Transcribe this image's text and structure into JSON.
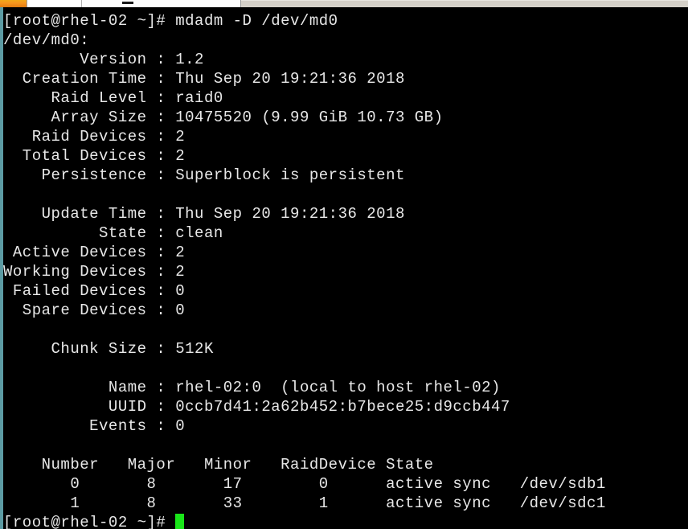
{
  "window": {
    "app_icon": "terminal-app-icon",
    "minimize_glyph": "minimize-icon",
    "title": ""
  },
  "terminal": {
    "colors": {
      "background": "#000000",
      "foreground": "#e8e8e8",
      "cursor": "#19e619",
      "border_left": "#5c9ba3",
      "chrome": "#d4d0c8",
      "icon_orange": "#f7941e"
    },
    "prompt": "[root@rhel-02 ~]#",
    "command": "mdadm -D /dev/md0",
    "lines": [
      "[root@rhel-02 ~]# mdadm -D /dev/md0",
      "/dev/md0:",
      "        Version : 1.2",
      "  Creation Time : Thu Sep 20 19:21:36 2018",
      "     Raid Level : raid0",
      "     Array Size : 10475520 (9.99 GiB 10.73 GB)",
      "   Raid Devices : 2",
      "  Total Devices : 2",
      "    Persistence : Superblock is persistent",
      "",
      "    Update Time : Thu Sep 20 19:21:36 2018",
      "          State : clean",
      " Active Devices : 2",
      "Working Devices : 2",
      " Failed Devices : 0",
      "  Spare Devices : 0",
      "",
      "     Chunk Size : 512K",
      "",
      "           Name : rhel-02:0  (local to host rhel-02)",
      "           UUID : 0ccb7d41:2a62b452:b7bece25:d9ccb447",
      "         Events : 0",
      "",
      "    Number   Major   Minor   RaidDevice State",
      "       0       8       17        0      active sync   /dev/sdb1",
      "       1       8       33        1      active sync   /dev/sdc1"
    ],
    "final_prompt": "[root@rhel-02 ~]# ",
    "cursor": "block-cursor"
  },
  "mdadm_detail": {
    "device": "/dev/md0",
    "fields": {
      "Version": "1.2",
      "Creation Time": "Thu Sep 20 19:21:36 2018",
      "Raid Level": "raid0",
      "Array Size": "10475520 (9.99 GiB 10.73 GB)",
      "Raid Devices": "2",
      "Total Devices": "2",
      "Persistence": "Superblock is persistent",
      "Update Time": "Thu Sep 20 19:21:36 2018",
      "State": "clean",
      "Active Devices": "2",
      "Working Devices": "2",
      "Failed Devices": "0",
      "Spare Devices": "0",
      "Chunk Size": "512K",
      "Name": "rhel-02:0  (local to host rhel-02)",
      "UUID": "0ccb7d41:2a62b452:b7bece25:d9ccb447",
      "Events": "0"
    },
    "table": {
      "headers": [
        "Number",
        "Major",
        "Minor",
        "RaidDevice",
        "State"
      ],
      "rows": [
        [
          "0",
          "8",
          "17",
          "0",
          "active sync",
          "/dev/sdb1"
        ],
        [
          "1",
          "8",
          "33",
          "1",
          "active sync",
          "/dev/sdc1"
        ]
      ]
    }
  }
}
